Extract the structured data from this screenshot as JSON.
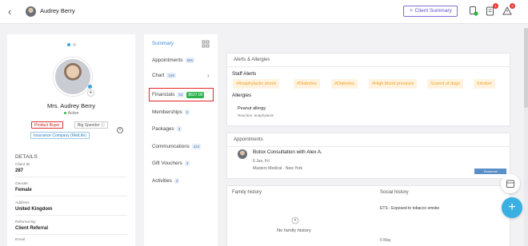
{
  "header": {
    "client_name": "Audrey Berry",
    "client_summary_label": "Client Summary",
    "icons": [
      "back-arrow-icon",
      "client-avatar",
      "notes-icon",
      "forms-icon",
      "alerts-icon"
    ],
    "notes_badge": "",
    "forms_badge": "1",
    "alerts_badge": "2"
  },
  "profile": {
    "full_name": "Mrs. Audrey Berry",
    "status": "Active",
    "tags": [
      "Product Buyer",
      "Big Spender ⓘ",
      "Insurance Company (MetLife)"
    ],
    "details_heading": "DETAILS",
    "fields": [
      {
        "label": "Client ID",
        "value": "287"
      },
      {
        "label": "Gender",
        "value": "Female"
      },
      {
        "label": "Address",
        "value": "United Kingdom"
      },
      {
        "label": "Referred By",
        "value": "Client Referral"
      },
      {
        "label": "Email",
        "value": ""
      }
    ]
  },
  "nav": {
    "items": [
      {
        "label": "Summary",
        "count": ""
      },
      {
        "label": "Appointments",
        "count": "589"
      },
      {
        "label": "Chart",
        "count": "109"
      },
      {
        "label": "Financials",
        "count": "53",
        "amount": "$637.00"
      },
      {
        "label": "Memberships",
        "count": "0"
      },
      {
        "label": "Packages",
        "count": "3"
      },
      {
        "label": "Communications",
        "count": "424"
      },
      {
        "label": "Gift Vouchers",
        "count": "3"
      },
      {
        "label": "Activities",
        "count": "3"
      }
    ]
  },
  "alerts": {
    "title": "Alerts & Allergies",
    "staff_alerts_heading": "Staff Alerts",
    "staff_alerts": [
      "#Anaphylactic shock",
      "#Diabetes",
      "#Diabetes",
      "#High blood pressure",
      "Scared of dogs",
      "Smoker"
    ],
    "allergies_heading": "Allergies",
    "allergy_name": "Peanut allergy",
    "allergy_reaction": "Reaction: anaphylaxis"
  },
  "appointments": {
    "title": "Appointments",
    "item_title": "Botox Consultation with Alex A.",
    "item_date": "6 Jun, Fri",
    "item_location": "Masters Medical - New York",
    "item_badge": "Tomorrow"
  },
  "family_history": {
    "title": "Family history",
    "empty_text": "No family history"
  },
  "social_history": {
    "title": "Social history",
    "entry": "ETS - Exposed to tobacco smoke",
    "entry_date": "6 May"
  },
  "colors": {
    "accent": "#3a8ad8",
    "alert_tag_bg": "#fff3e0",
    "alert_tag_text": "#f0a020",
    "financial_amount": "#2cb24b",
    "highlight_box": "#e52525",
    "fab": "#3ab0e2"
  }
}
